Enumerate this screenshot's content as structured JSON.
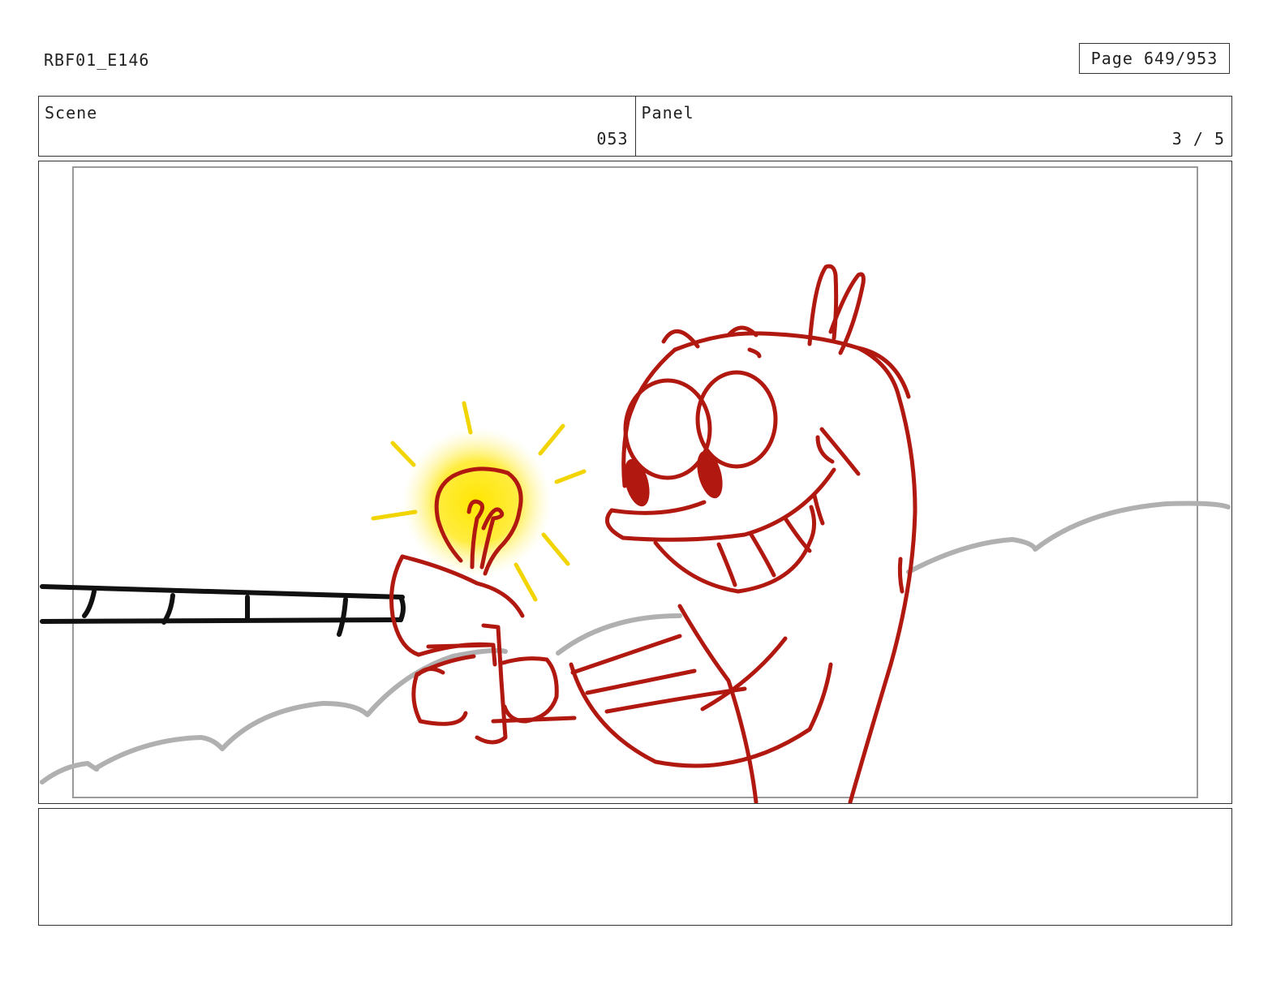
{
  "header": {
    "production_code": "RBF01_E146",
    "page_label": "Page 649/953"
  },
  "scene": {
    "label": "Scene",
    "value": "053"
  },
  "panel": {
    "label": "Panel",
    "value": "3 / 5"
  },
  "drawing": {
    "subject": "character-holding-glowing-light-bulb-on-pole",
    "colors": {
      "character_line": "#b01810",
      "pole_line": "#111111",
      "cloud_line": "#b0b0b0",
      "glow": "#ffe600",
      "rays": "#f2d400"
    }
  },
  "notes": {
    "text": ""
  }
}
